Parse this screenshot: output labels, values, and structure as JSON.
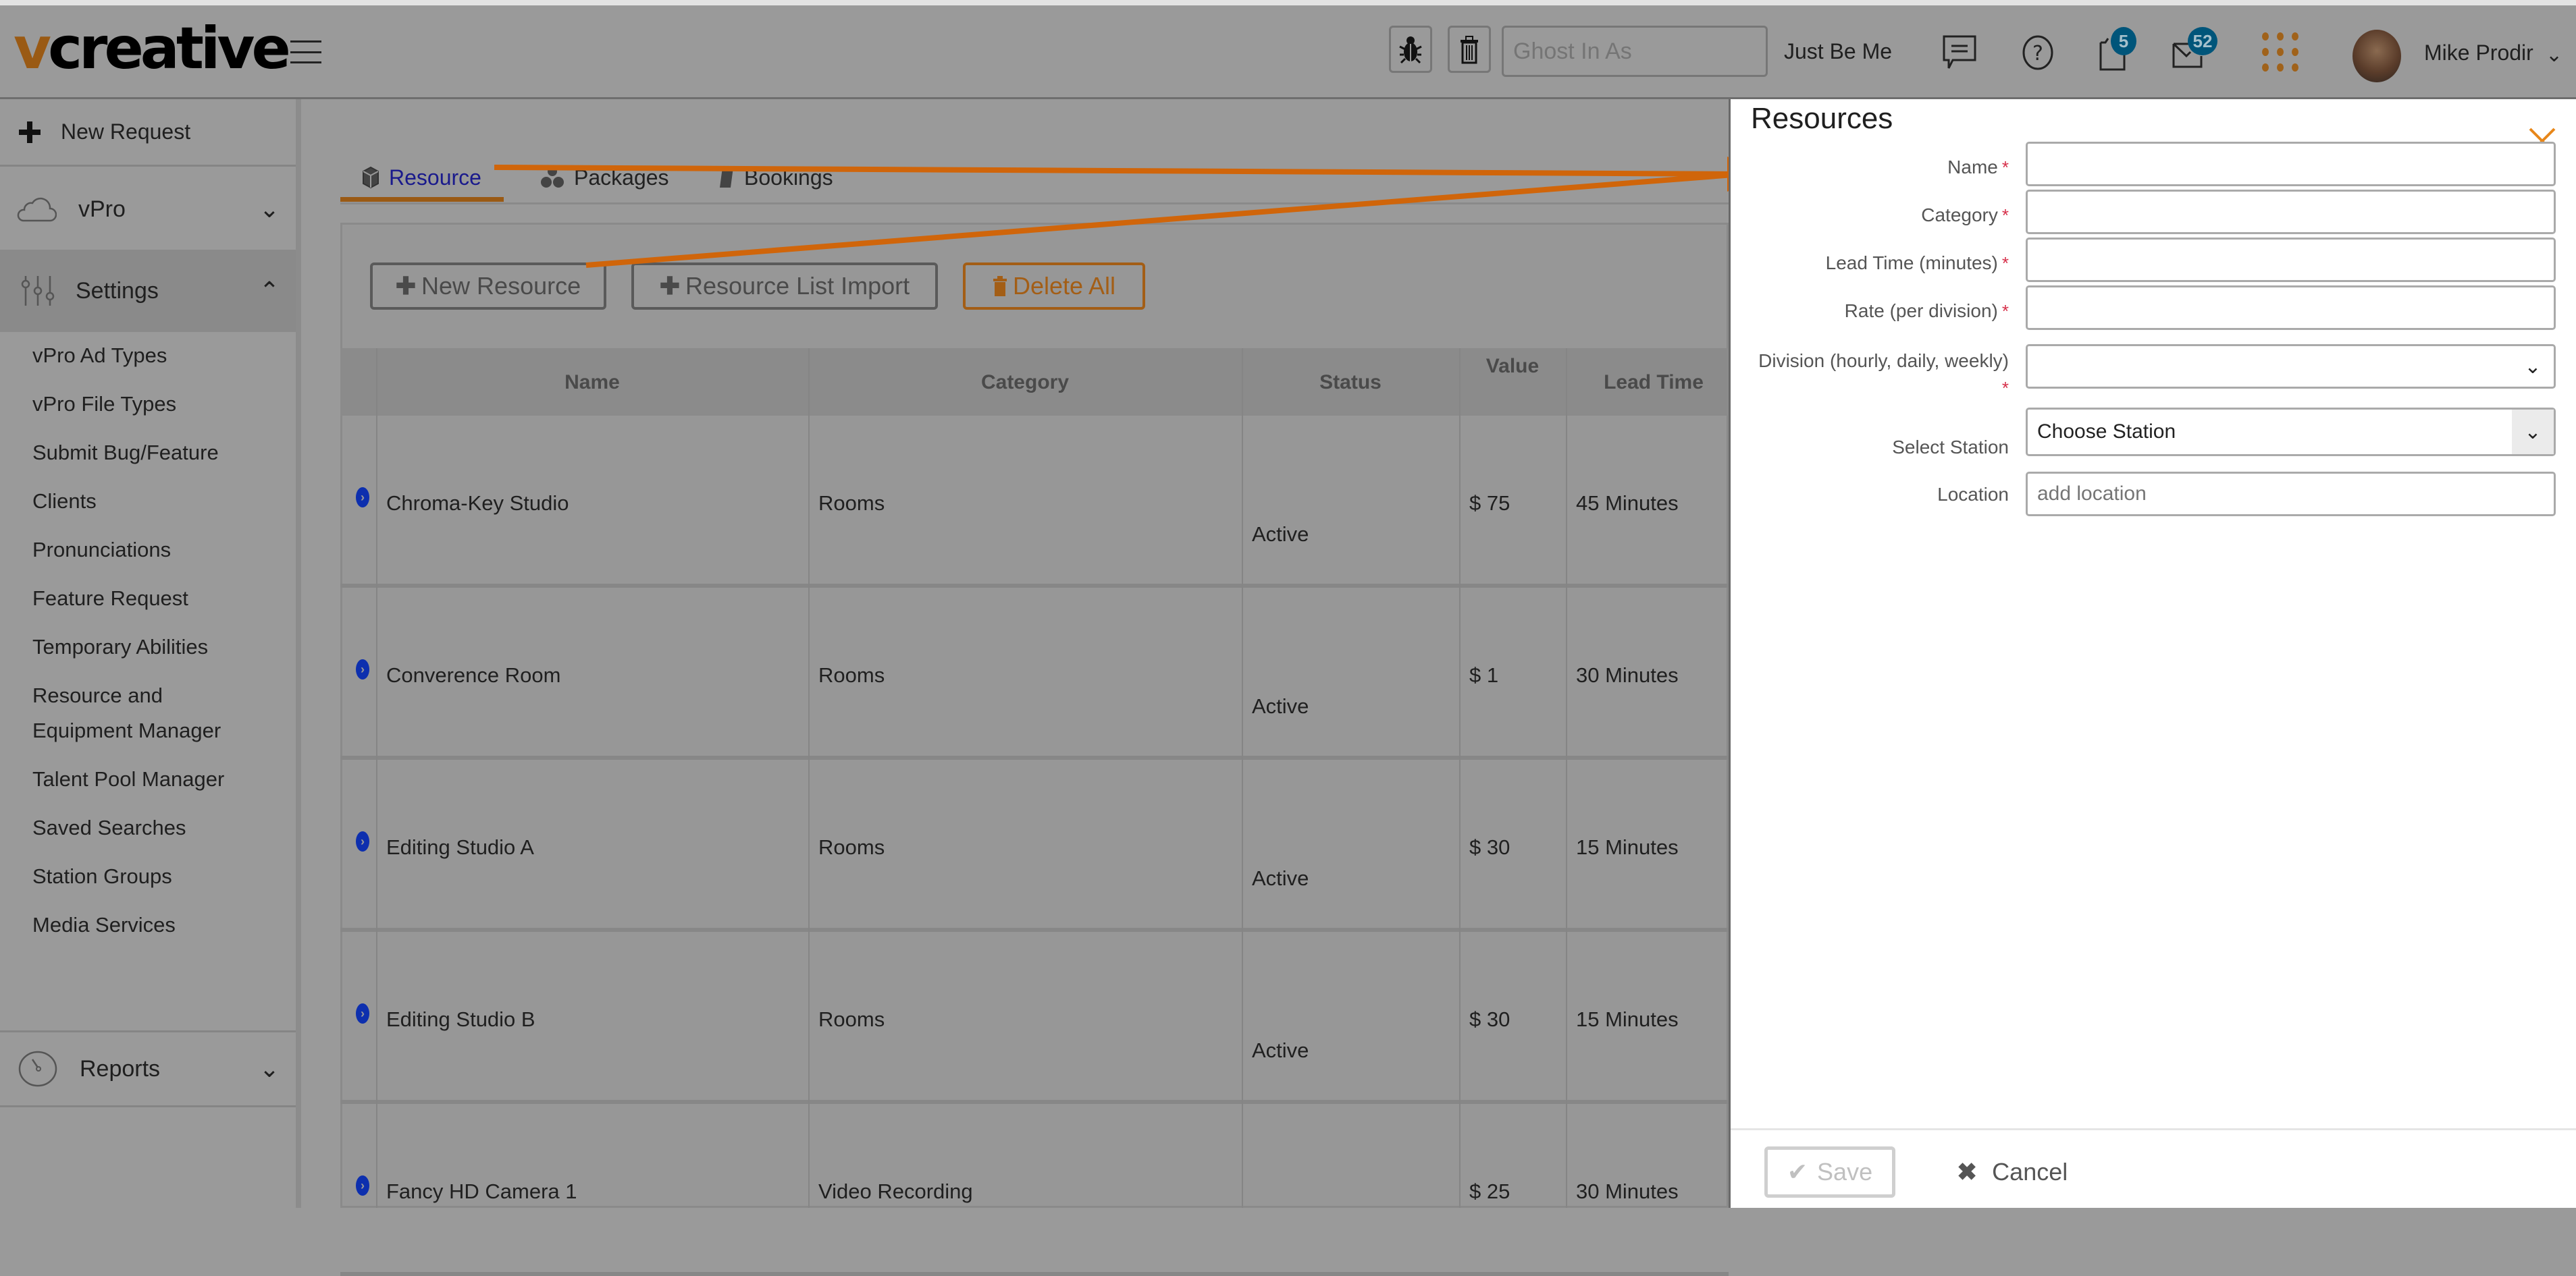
{
  "header": {
    "logo_v": "v",
    "logo_rest": "creative",
    "ghost_placeholder": "Ghost In As",
    "just_be_me": "Just Be Me",
    "notifications_count": "5",
    "messages_count": "52",
    "user_name": "Mike Prodir"
  },
  "sidebar": {
    "new_request": "New Request",
    "vpro": "vPro",
    "settings": "Settings",
    "settings_items": [
      "vPro Ad Types",
      "vPro File Types",
      "Submit Bug/Feature",
      "Clients",
      "Pronunciations",
      "Feature Request",
      "Temporary Abilities",
      "Resource and",
      "Equipment Manager",
      "Talent Pool Manager",
      "Saved Searches",
      "Station Groups",
      "Media Services"
    ],
    "reports": "Reports"
  },
  "main": {
    "tabs": [
      {
        "label": "Resource",
        "active": true
      },
      {
        "label": "Packages",
        "active": false
      },
      {
        "label": "Bookings",
        "active": false
      }
    ],
    "buttons": {
      "new_resource": "New Resource",
      "import": "Resource List Import",
      "delete_all": "Delete All"
    },
    "table": {
      "columns": [
        "Name",
        "Category",
        "Status",
        "Value",
        "Lead Time"
      ],
      "rows": [
        {
          "name": "Chroma-Key Studio",
          "category": "Rooms",
          "status": "Active",
          "value": "$ 75",
          "lead_time": "45 Minutes"
        },
        {
          "name": "Converence Room",
          "category": "Rooms",
          "status": "Active",
          "value": "$ 1",
          "lead_time": "30 Minutes"
        },
        {
          "name": "Editing Studio A",
          "category": "Rooms",
          "status": "Active",
          "value": "$ 30",
          "lead_time": "15 Minutes"
        },
        {
          "name": "Editing Studio B",
          "category": "Rooms",
          "status": "Active",
          "value": "$ 30",
          "lead_time": "15 Minutes"
        },
        {
          "name": "Fancy HD Camera 1",
          "category": "Video Recording",
          "status": "",
          "value": "$ 25",
          "lead_time": "30 Minutes"
        }
      ]
    }
  },
  "resource_panel": {
    "title": "Resources",
    "fields": {
      "name": {
        "label": "Name",
        "value": "",
        "required": true
      },
      "category": {
        "label": "Category",
        "value": "",
        "required": true
      },
      "lead_time": {
        "label": "Lead Time (minutes)",
        "value": "",
        "required": true
      },
      "rate": {
        "label": "Rate (per division)",
        "value": "",
        "required": true
      },
      "division": {
        "label": "Division (hourly, daily, weekly)",
        "value": "",
        "required": true
      },
      "station": {
        "label": "Select Station",
        "value": "Choose Station"
      },
      "location": {
        "label": "Location",
        "value": "add location"
      }
    },
    "required_mark": "*",
    "save": "Save",
    "cancel": "Cancel"
  },
  "colors": {
    "brand": "#9a5a14",
    "annotation_arrow": "#d0650a",
    "badge": "#00557a",
    "required": "#d6304a",
    "active_tab": "#1a1a8c"
  }
}
